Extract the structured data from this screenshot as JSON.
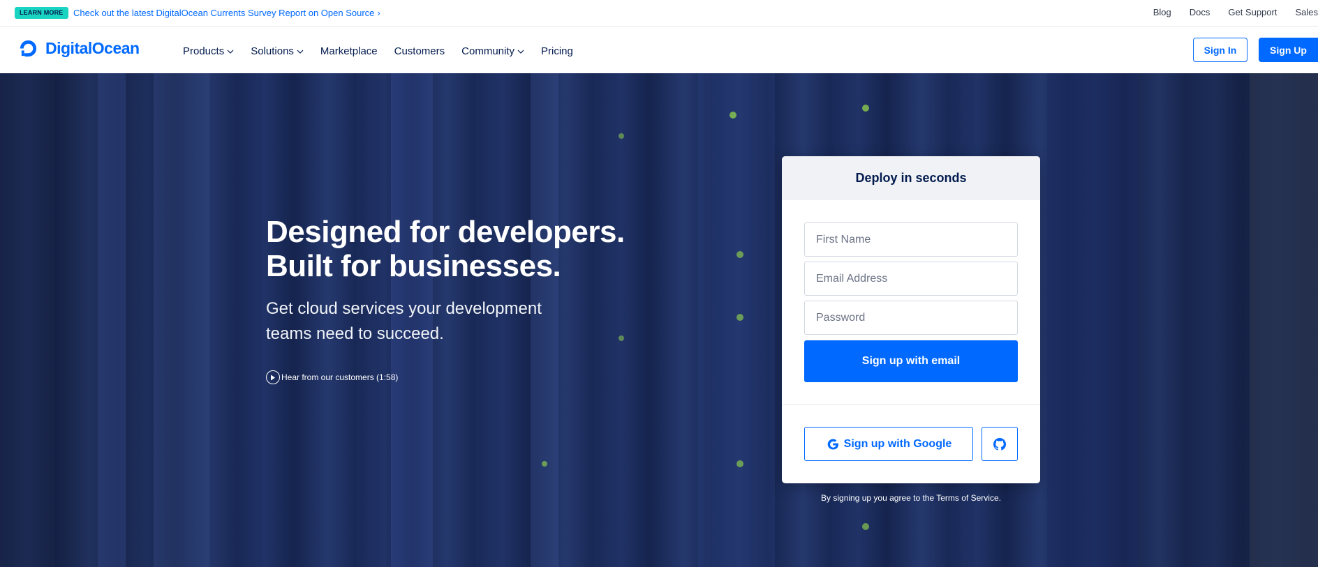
{
  "announcement": {
    "badge": "LEARN MORE",
    "link": "Check out the latest DigitalOcean Currents Survey Report on Open Source"
  },
  "utility_links": [
    "Blog",
    "Docs",
    "Get Support",
    "Sales"
  ],
  "brand": {
    "name": "DigitalOcean",
    "color": "#0069ff"
  },
  "nav": {
    "items": [
      {
        "label": "Products",
        "dropdown": true
      },
      {
        "label": "Solutions",
        "dropdown": true
      },
      {
        "label": "Marketplace",
        "dropdown": false
      },
      {
        "label": "Customers",
        "dropdown": false
      },
      {
        "label": "Community",
        "dropdown": true
      },
      {
        "label": "Pricing",
        "dropdown": false
      }
    ],
    "sign_in": "Sign In",
    "sign_up": "Sign Up"
  },
  "hero": {
    "title_line1": "Designed for developers.",
    "title_line2": "Built for businesses.",
    "subtitle": "Get cloud services your development teams need to succeed.",
    "video_link": "Hear from our customers (1:58)"
  },
  "signup_card": {
    "heading": "Deploy in seconds",
    "first_name_placeholder": "First Name",
    "email_placeholder": "Email Address",
    "password_placeholder": "Password",
    "email_button": "Sign up with email",
    "google_button": "Sign up with Google",
    "github_icon": "github-icon",
    "terms": "By signing up you agree to the Terms of Service."
  }
}
